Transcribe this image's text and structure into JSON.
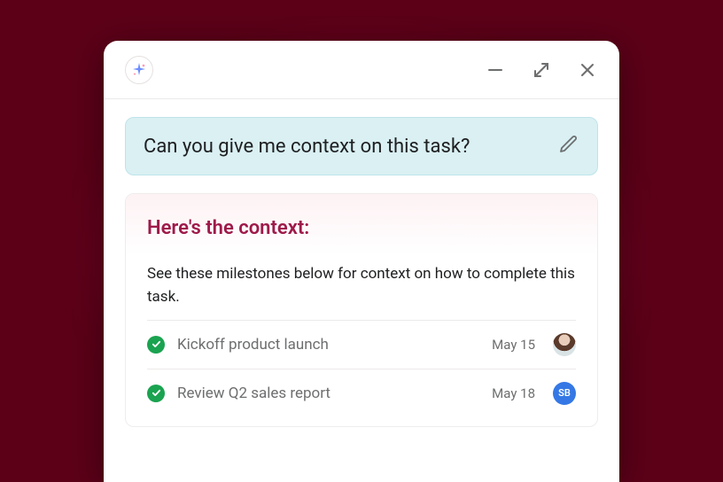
{
  "icons": {
    "ai": "sparkle-icon",
    "minimize": "minimize-icon",
    "expand": "expand-icon",
    "close": "close-icon",
    "edit": "pencil-icon",
    "check": "check-icon"
  },
  "colors": {
    "background": "#5c0018",
    "prompt_bg": "#daf0f3",
    "accent": "#9e1a4a",
    "check_green": "#1aa350",
    "avatar_blue": "#3578e5"
  },
  "prompt": {
    "text": "Can you give me context on this task?"
  },
  "response": {
    "title": "Here's the context:",
    "description": "See these milestones below for context on how to complete this task.",
    "milestones": [
      {
        "title": "Kickoff product launch",
        "date": "May 15",
        "assignee_kind": "photo",
        "assignee_label": ""
      },
      {
        "title": "Review Q2 sales report",
        "date": "May 18",
        "assignee_kind": "initials",
        "assignee_label": "SB"
      }
    ]
  }
}
